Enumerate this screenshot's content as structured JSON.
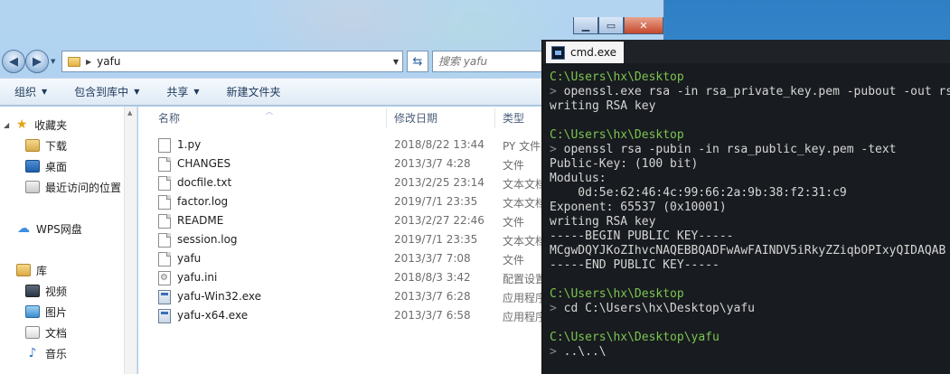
{
  "explorer": {
    "address": {
      "folder": "yafu"
    },
    "search": {
      "placeholder": "搜索 yafu"
    },
    "toolbar": {
      "organize": "组织",
      "include": "包含到库中",
      "share": "共享",
      "new_folder": "新建文件夹"
    },
    "nav": {
      "favorites": "收藏夹",
      "downloads": "下载",
      "desktop": "桌面",
      "recent": "最近访问的位置",
      "wps": "WPS网盘",
      "library": "库",
      "video": "视频",
      "pictures": "图片",
      "documents": "文档",
      "music": "音乐"
    },
    "columns": {
      "name": "名称",
      "modified": "修改日期",
      "type": "类型"
    },
    "files": [
      {
        "name": "1.py",
        "date": "2018/8/22 13:44",
        "type": "PY 文件",
        "icon": "python-file-icon"
      },
      {
        "name": "CHANGES",
        "date": "2013/3/7 4:28",
        "type": "文件",
        "icon": "document-icon"
      },
      {
        "name": "docfile.txt",
        "date": "2013/2/25 23:14",
        "type": "文本文档",
        "icon": "text-file-icon"
      },
      {
        "name": "factor.log",
        "date": "2019/7/1 23:35",
        "type": "文本文档",
        "icon": "text-file-icon"
      },
      {
        "name": "README",
        "date": "2013/2/27 22:46",
        "type": "文件",
        "icon": "document-icon"
      },
      {
        "name": "session.log",
        "date": "2019/7/1 23:35",
        "type": "文本文档",
        "icon": "text-file-icon"
      },
      {
        "name": "yafu",
        "date": "2013/3/7 7:08",
        "type": "文件",
        "icon": "document-icon"
      },
      {
        "name": "yafu.ini",
        "date": "2018/8/3 3:42",
        "type": "配置设置",
        "icon": "settings-file-icon"
      },
      {
        "name": "yafu-Win32.exe",
        "date": "2013/3/7 6:28",
        "type": "应用程序",
        "icon": "exe-icon"
      },
      {
        "name": "yafu-x64.exe",
        "date": "2013/3/7 6:58",
        "type": "应用程序",
        "icon": "exe-icon"
      }
    ]
  },
  "cmd": {
    "tab_title": "cmd.exe",
    "lines": [
      {
        "kind": "path",
        "text": "C:\\Users\\hx\\Desktop"
      },
      {
        "kind": "cmd",
        "text": "openssl.exe rsa -in rsa_private_key.pem -pubout -out rsa_public_key.pem"
      },
      {
        "kind": "out",
        "text": "writing RSA key"
      },
      {
        "kind": "blank",
        "text": ""
      },
      {
        "kind": "path",
        "text": "C:\\Users\\hx\\Desktop"
      },
      {
        "kind": "cmd",
        "text": "openssl rsa -pubin -in rsa_public_key.pem -text"
      },
      {
        "kind": "out",
        "text": "Public-Key: (100 bit)"
      },
      {
        "kind": "out",
        "text": "Modulus:"
      },
      {
        "kind": "out",
        "text": "    0d:5e:62:46:4c:99:66:2a:9b:38:f2:31:c9"
      },
      {
        "kind": "out",
        "text": "Exponent: 65537 (0x10001)"
      },
      {
        "kind": "out",
        "text": "writing RSA key"
      },
      {
        "kind": "out",
        "text": "-----BEGIN PUBLIC KEY-----"
      },
      {
        "kind": "out",
        "text": "MCgwDQYJKoZIhvcNAQEBBQADFwAwFAINDV5iRkyZZiqbOPIxyQIDAQAB"
      },
      {
        "kind": "out",
        "text": "-----END PUBLIC KEY-----"
      },
      {
        "kind": "blank",
        "text": ""
      },
      {
        "kind": "path",
        "text": "C:\\Users\\hx\\Desktop"
      },
      {
        "kind": "cmd",
        "text": "cd C:\\Users\\hx\\Desktop\\yafu"
      },
      {
        "kind": "blank",
        "text": ""
      },
      {
        "kind": "path",
        "text": "C:\\Users\\hx\\Desktop\\yafu"
      },
      {
        "kind": "cmd",
        "text": "..\\..\\"
      }
    ]
  }
}
